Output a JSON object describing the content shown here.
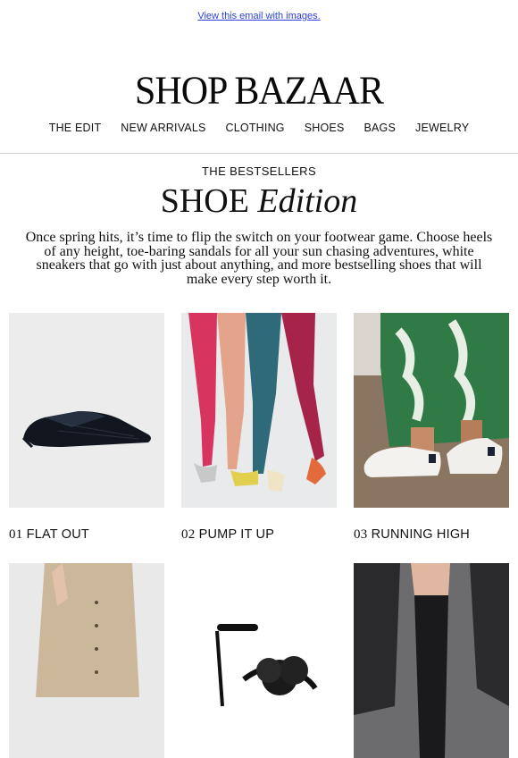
{
  "header": {
    "view_link": "View this email with images.",
    "logo": "SHOP BAZAAR"
  },
  "nav": [
    "THE EDIT",
    "NEW ARRIVALS",
    "CLOTHING",
    "SHOES",
    "BAGS",
    "JEWELRY"
  ],
  "hero": {
    "kicker": "THE BESTSELLERS",
    "title_main": "SHOE",
    "title_italic": "Edition",
    "intro": "Once spring hits, it’s time to flip the switch on your footwear game. Choose heels of any height, toe-baring sandals for all your sun chasing adventures, white sneakers that go with just about anything, and more bestselling shoes that will make every step worth it."
  },
  "products": [
    {
      "num": "01",
      "label": "FLAT OUT",
      "icon": "woven-flat-shoe-image"
    },
    {
      "num": "02",
      "label": "PUMP IT UP",
      "icon": "colored-tights-pumps-image"
    },
    {
      "num": "03",
      "label": "RUNNING HIGH",
      "icon": "white-sneakers-image"
    },
    {
      "num": "",
      "label": "",
      "icon": "midi-skirt-image"
    },
    {
      "num": "",
      "label": "",
      "icon": "feather-sandal-image"
    },
    {
      "num": "",
      "label": "",
      "icon": "sheer-socks-image"
    }
  ],
  "colors": {
    "link": "#2b3fd6",
    "text": "#111111",
    "divider": "#cfcfcf"
  }
}
